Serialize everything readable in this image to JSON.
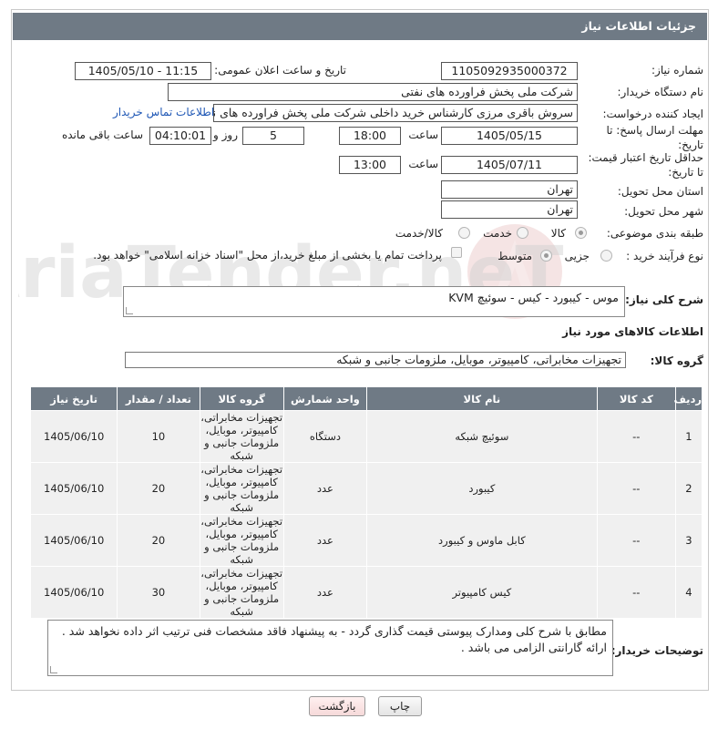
{
  "header": {
    "title": "جزئیات اطلاعات نیاز"
  },
  "fields": {
    "need_number_label": "شماره نیاز:",
    "need_number": "1105092935000372",
    "announce_label": "تاریخ و ساعت اعلان عمومی:",
    "announce_value": "1405/05/10 - 11:15",
    "buyer_org_label": "نام دستگاه خریدار:",
    "buyer_org": "شرکت ملی پخش فراورده های نفتی",
    "creator_label": "ایجاد کننده درخواست:",
    "creator": "سروش باقری مرزی کارشناس خرید داخلی شرکت ملی پخش فراورده های نفتی",
    "contact_link": "اطلاعات تماس خریدار",
    "reply_deadline_label_1": "مهلت ارسال پاسخ: تا",
    "reply_deadline_label_2": "تاریخ:",
    "reply_date": "1405/05/15",
    "time_label": "ساعت",
    "reply_time": "18:00",
    "days_value": "5",
    "days_label": "روز و",
    "remaining_time": "04:10:01",
    "remaining_label": "ساعت باقی مانده",
    "price_validity_label_1": "حداقل تاریخ اعتبار قیمت:",
    "price_validity_label_2": "تا تاریخ:",
    "price_date": "1405/07/11",
    "price_time": "13:00",
    "province_label": "استان محل تحویل:",
    "province": "تهران",
    "city_label": "شهر محل تحویل:",
    "city": "تهران",
    "category_label": "طبقه بندی موضوعی:",
    "category_options": [
      "کالا",
      "خدمت",
      "کالا/خدمت"
    ],
    "category_selected": "کالا",
    "process_label": "نوع فرآیند خرید :",
    "process_options": [
      "جزیی",
      "متوسط"
    ],
    "process_selected": "متوسط",
    "payment_note": "پرداخت تمام یا بخشی از مبلغ خرید،از محل \"اسناد خزانه اسلامی\" خواهد بود.",
    "general_desc_label": "شرح کلی نیاز:",
    "general_desc": "موس - کیبورد - کیس - سوئیچ KVM",
    "goods_info_title": "اطلاعات کالاهای مورد نیاز",
    "goods_group_label": "گروه کالا:",
    "goods_group": "تجهیزات مخابراتی، کامپیوتر، موبایل، ملزومات جانبی و شبکه",
    "buyer_notes_label": "توضیحات خریدار:",
    "buyer_notes": "مطابق با شرح کلی ومدارک پیوستی قیمت گذاری گردد - به پیشنهاد فاقد مشخصات فنی ترتیب اثر داده نخواهد شد . ارائه گارانتی الزامی می باشد ."
  },
  "table": {
    "headers": [
      "ردیف",
      "کد کالا",
      "نام کالا",
      "واحد شمارش",
      "گروه کالا",
      "تعداد / مقدار",
      "تاریخ نیاز"
    ],
    "rows": [
      [
        "1",
        "--",
        "سوئیچ شبکه",
        "دستگاه",
        "تجهیزات مخابراتی، کامپیوتر، موبایل، ملزومات جانبی و شبکه",
        "10",
        "1405/06/10"
      ],
      [
        "2",
        "--",
        "کیبورد",
        "عدد",
        "تجهیزات مخابراتی، کامپیوتر، موبایل، ملزومات جانبی و شبکه",
        "20",
        "1405/06/10"
      ],
      [
        "3",
        "--",
        "کابل ماوس و کیبورد",
        "عدد",
        "تجهیزات مخابراتی، کامپیوتر، موبایل، ملزومات جانبی و شبکه",
        "20",
        "1405/06/10"
      ],
      [
        "4",
        "--",
        "کیس کامپیوتر",
        "عدد",
        "تجهیزات مخابراتی، کامپیوتر، موبایل، ملزومات جانبی و شبکه",
        "30",
        "1405/06/10"
      ]
    ]
  },
  "buttons": {
    "print": "چاپ",
    "back": "بازگشت"
  },
  "watermark": {
    "text": "AriaTender.neT"
  },
  "colors": {
    "header_bg": "#6f7a85",
    "link": "#1f57b5",
    "cell_bg": "#f0f0f0"
  }
}
